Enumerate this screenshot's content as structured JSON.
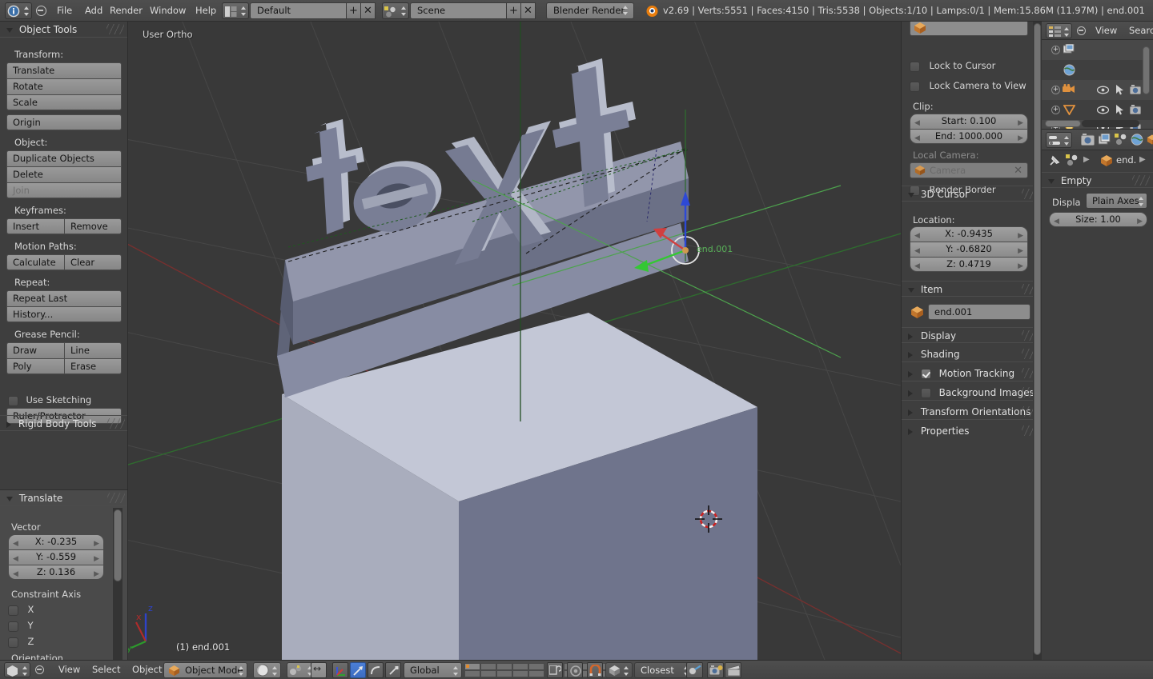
{
  "app": {
    "title": "Blender",
    "version_info": "v2.69 | Verts:5551 | Faces:4150 | Tris:5538 | Objects:1/10 | Lamps:0/1 | Mem:15.86M (11.97M) | end.001"
  },
  "topbar": {
    "menus": [
      "File",
      "Add",
      "Render",
      "Window",
      "Help"
    ],
    "screen_layout": "Default",
    "scene": "Scene",
    "render_engine": "Blender Render",
    "add_icon": "plus-icon",
    "remove_icon": "cross-icon",
    "info_icon": "info-editor-icon",
    "collapse_icon": "collapse-menu-icon"
  },
  "toolshelf": {
    "panel_title": "Object Tools",
    "groups": [
      {
        "label": "Transform:",
        "buttons": [
          [
            "Translate"
          ],
          [
            "Rotate"
          ],
          [
            "Scale"
          ]
        ]
      },
      {
        "label": "",
        "buttons": [
          [
            "Origin"
          ]
        ]
      },
      {
        "label": "Object:",
        "buttons": [
          [
            "Duplicate Objects"
          ],
          [
            "Delete"
          ],
          [
            "Join"
          ]
        ]
      },
      {
        "label": "Keyframes:",
        "buttons": [
          [
            "Insert",
            "Remove"
          ]
        ]
      },
      {
        "label": "Motion Paths:",
        "buttons": [
          [
            "Calculate",
            "Clear"
          ]
        ]
      },
      {
        "label": "Repeat:",
        "buttons": [
          [
            "Repeat Last"
          ],
          [
            "History..."
          ]
        ]
      },
      {
        "label": "Grease Pencil:",
        "buttons": [
          [
            "Draw",
            "Line"
          ],
          [
            "Poly",
            "Erase"
          ]
        ]
      }
    ],
    "use_sketching_sessions": {
      "label": "Use Sketching Sessions",
      "checked": false
    },
    "ruler_button": "Ruler/Protractor",
    "rigid_body_tools": "Rigid Body Tools",
    "operator_panel": {
      "title": "Translate",
      "vector_label": "Vector",
      "vector": [
        "X: -0.235",
        "Y: -0.559",
        "Z: 0.136"
      ],
      "constraint_axis_label": "Constraint Axis",
      "axes": [
        {
          "label": "X",
          "checked": false
        },
        {
          "label": "Y",
          "checked": false
        },
        {
          "label": "Z",
          "checked": false
        }
      ],
      "orientation_label": "Orientation"
    }
  },
  "viewport": {
    "view_name": "User Ortho",
    "active_object_label": "(1) end.001",
    "manipulator_label": "end.001",
    "axis_gizmo": {
      "x": "x",
      "y": "y",
      "z": "z"
    },
    "object_3d_text": "text",
    "colors": {
      "background": "#393939",
      "grid": "#4a4a4a",
      "axis_x": "#7d2b2b",
      "axis_y": "#2f6b2f",
      "manip_x": "#d13f3f",
      "manip_y": "#34c734",
      "manip_z": "#2d49d6",
      "text_object": "#7b8097",
      "cube_object": "#6d7287"
    }
  },
  "npanel": {
    "view_object_field": "",
    "view_object_icon": "object-cube-icon",
    "lock_to_cursor": {
      "label": "Lock to Cursor",
      "checked": false
    },
    "lock_camera_to_view": {
      "label": "Lock Camera to View",
      "checked": false
    },
    "clip_label": "Clip:",
    "clip_start": "Start: 0.100",
    "clip_end": "End: 1000.000",
    "local_camera_label": "Local Camera:",
    "local_camera_value": "Camera",
    "render_border": {
      "label": "Render Border",
      "checked": false
    },
    "cursor_panel": {
      "title": "3D Cursor",
      "location_label": "Location:",
      "location": [
        "X: -0.9435",
        "Y: -0.6820",
        "Z: 0.4719"
      ]
    },
    "item_panel": {
      "title": "Item",
      "object_name": "end.001",
      "object_icon": "object-empty-icon"
    },
    "collapsed_panels": [
      {
        "title": "Display",
        "checkbox": null
      },
      {
        "title": "Shading",
        "checkbox": null
      },
      {
        "title": "Motion Tracking",
        "checkbox": true
      },
      {
        "title": "Background Images",
        "checkbox": false
      },
      {
        "title": "Transform Orientations",
        "checkbox": null
      },
      {
        "title": "Properties",
        "checkbox": null
      }
    ]
  },
  "outliner": {
    "editor_icon": "outliner-editor-icon",
    "collapse_icon": "collapse-menu-icon",
    "menus": [
      "View",
      "Searc"
    ],
    "rows": [
      {
        "icon": "images-icon",
        "expand": true,
        "restrict": false
      },
      {
        "icon": "world-icon",
        "expand": false,
        "restrict": false
      },
      {
        "icon": "camera-icon",
        "expand": true,
        "restrict": true
      },
      {
        "icon": "cone-icon",
        "expand": true,
        "restrict": true
      },
      {
        "icon": "lamp-icon",
        "expand": true,
        "restrict": true
      }
    ],
    "restrict_icons": [
      "eye-icon",
      "cursor-arrow-icon",
      "camera-render-icon"
    ]
  },
  "properties": {
    "editor_icon": "properties-editor-icon",
    "tabs": [
      "render-tab-icon",
      "scene-tab-icon",
      "world-tab-icon",
      "object-tab-icon"
    ],
    "breadcrumb_pin_icon": "pin-icon",
    "breadcrumb_scene_icon": "scene-icon",
    "breadcrumb_object_icon": "object-cube-icon",
    "breadcrumb_object": "end.",
    "panel": {
      "title": "Empty",
      "display_as_label": "Displa",
      "display_as_value": "Plain Axes",
      "size_value": "Size: 1.00"
    }
  },
  "bottombar": {
    "editor_icon": "view3d-editor-icon",
    "collapse_icon": "collapse-menu-icon",
    "menus": [
      "View",
      "Select",
      "Object"
    ],
    "mode": "Object Mode",
    "mode_icon": "object-cube-icon",
    "viewport_shading_icon": "solid-shading-icon",
    "pivot_icon": "pivot-median-icon",
    "manipulator_icons": [
      "translate-manip-icon",
      "rotate-manip-icon",
      "scale-manip-icon"
    ],
    "transform_orientation": "Global",
    "layers_label": "layers",
    "proportional_edit_icon": "proportional-off-icon",
    "snap_magnet_icon": "snap-magnet-icon",
    "snap_element_icon": "snap-vertex-icon",
    "snap_target": "Closest",
    "snap_peel_icon": "snap-peel-icon",
    "render_icons": [
      "render-opengl-image-icon",
      "render-opengl-anim-icon"
    ]
  }
}
